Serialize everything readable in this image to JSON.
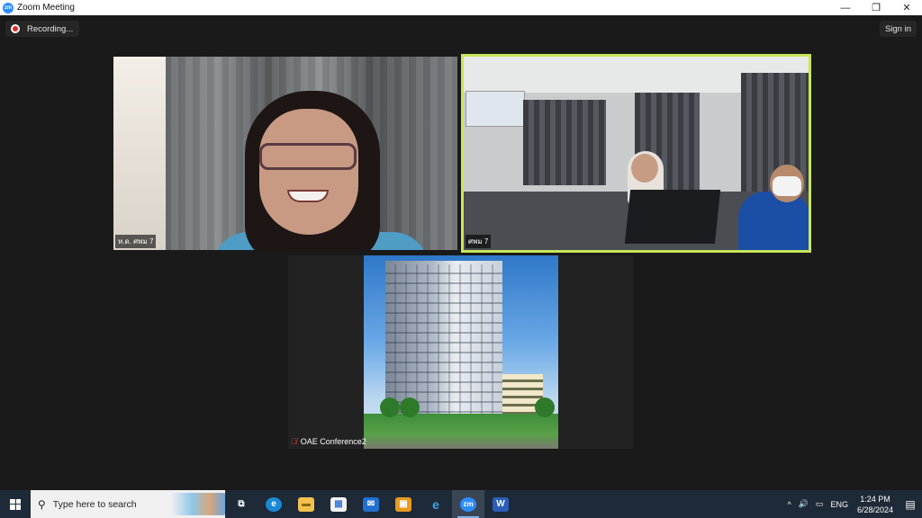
{
  "window": {
    "title": "Zoom Meeting",
    "app_icon_text": "zm",
    "controls": [
      "—",
      "❐",
      "✕"
    ]
  },
  "meeting": {
    "recording_label": "Recording...",
    "signin_label": "Sign in",
    "tiles": [
      {
        "label": "ห.ด. ศพม 7",
        "highlighted": false
      },
      {
        "label": "ศพม 7",
        "highlighted": true,
        "highlight_color": "#c8e65a"
      },
      {
        "label": "OAE Conference2",
        "muted": true
      }
    ]
  },
  "taskbar": {
    "search_placeholder": "Type here to search",
    "apps": [
      {
        "name": "task-view",
        "glyph": "⧉"
      },
      {
        "name": "edge",
        "glyph": "e"
      },
      {
        "name": "file-explorer",
        "glyph": "▬"
      },
      {
        "name": "store",
        "glyph": "▦"
      },
      {
        "name": "mail",
        "glyph": "✉"
      },
      {
        "name": "app-orange",
        "glyph": "▣"
      },
      {
        "name": "internet-explorer",
        "glyph": "e"
      },
      {
        "name": "zoom",
        "glyph": "zm",
        "active": true
      },
      {
        "name": "word",
        "glyph": "W"
      }
    ],
    "tray": {
      "chevron": "^",
      "volume": "🔊",
      "network": "▭",
      "language": "ENG",
      "time": "1:24 PM",
      "date": "6/28/2024",
      "notifications": "▤"
    }
  }
}
